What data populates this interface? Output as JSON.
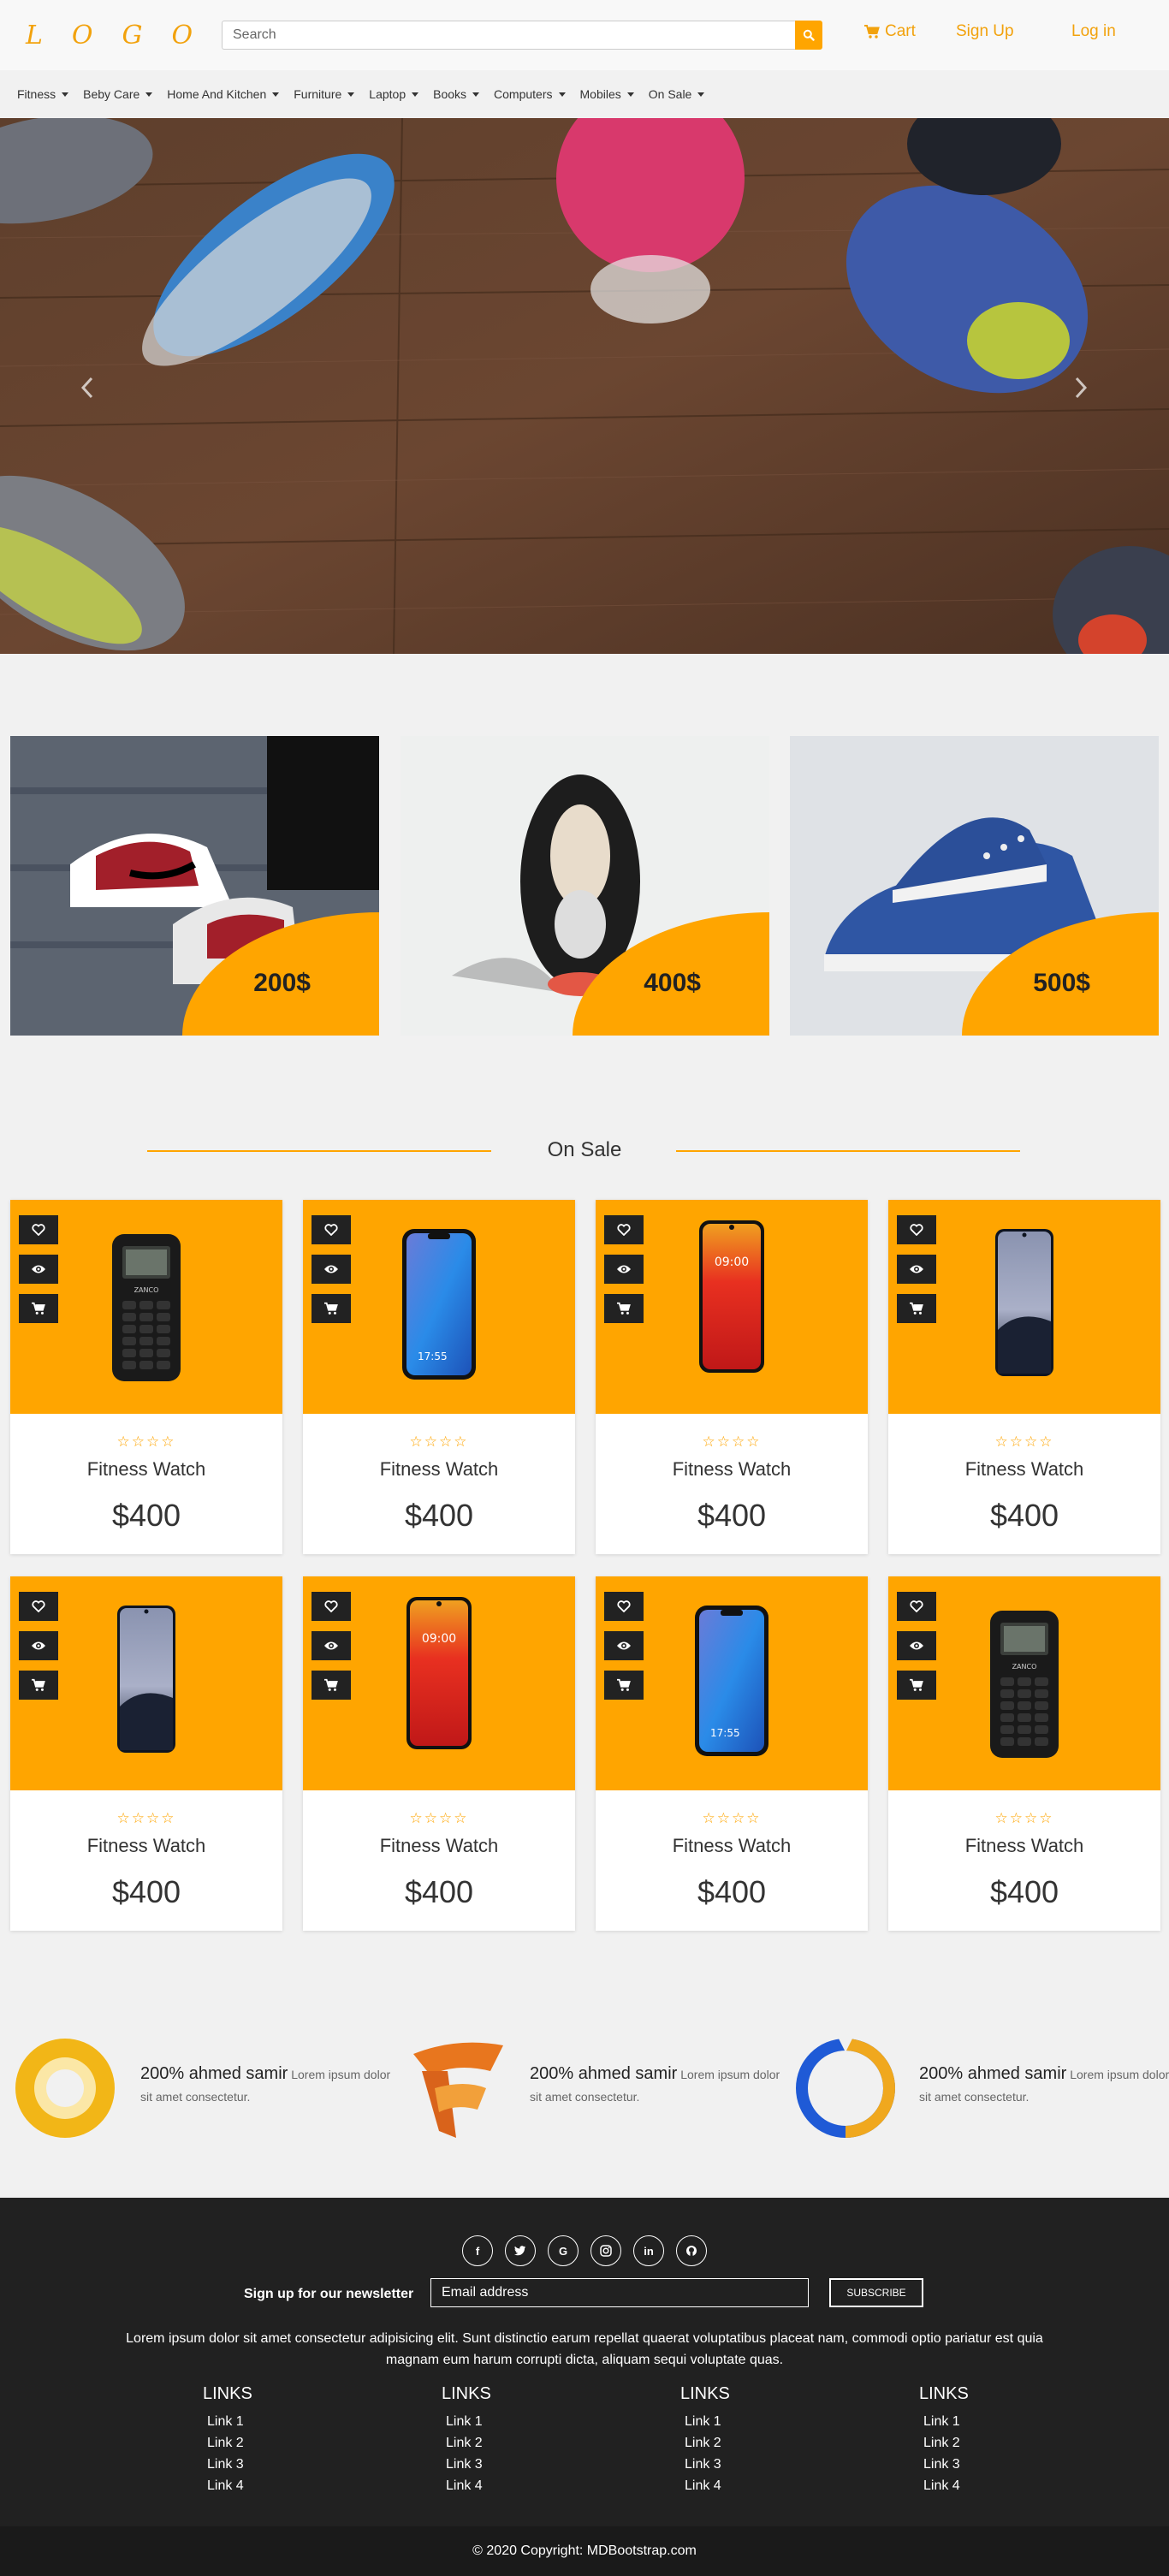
{
  "header": {
    "logo": "LOGO",
    "search_placeholder": "Search",
    "cart_label": "Cart",
    "signup_label": "Sign Up",
    "login_label": "Log in",
    "accent_color": "#ffa500"
  },
  "categories": [
    "Fitness",
    "Beby Care",
    "Home And Kitchen",
    "Furniture",
    "Laptop",
    "Books",
    "Computers",
    "Mobiles",
    "On Sale"
  ],
  "promos": [
    {
      "price": "200$"
    },
    {
      "price": "400$"
    },
    {
      "price": "500$"
    }
  ],
  "on_sale": {
    "title": "On Sale",
    "products": [
      {
        "name": "Fitness Watch",
        "price": "$400",
        "stars": "☆☆☆☆",
        "phone": "keypad"
      },
      {
        "name": "Fitness Watch",
        "price": "$400",
        "stars": "☆☆☆☆",
        "phone": "blue"
      },
      {
        "name": "Fitness Watch",
        "price": "$400",
        "stars": "☆☆☆☆",
        "phone": "red"
      },
      {
        "name": "Fitness Watch",
        "price": "$400",
        "stars": "☆☆☆☆",
        "phone": "dark"
      },
      {
        "name": "Fitness Watch",
        "price": "$400",
        "stars": "☆☆☆☆",
        "phone": "dark"
      },
      {
        "name": "Fitness Watch",
        "price": "$400",
        "stars": "☆☆☆☆",
        "phone": "red"
      },
      {
        "name": "Fitness Watch",
        "price": "$400",
        "stars": "☆☆☆☆",
        "phone": "blue"
      },
      {
        "name": "Fitness Watch",
        "price": "$400",
        "stars": "☆☆☆☆",
        "phone": "keypad"
      }
    ]
  },
  "features": [
    {
      "title": "200% ahmed samir",
      "text": "Lorem ipsum dolor sit amet consectetur."
    },
    {
      "title": "200% ahmed samir",
      "text": "Lorem ipsum dolor sit amet consectetur."
    },
    {
      "title": "200% ahmed samir",
      "text": "Lorem ipsum dolor sit amet consectetur."
    }
  ],
  "footer": {
    "socials": [
      "f",
      "t",
      "G",
      "ig",
      "in",
      "gh"
    ],
    "newsletter_label": "Sign up for our newsletter",
    "email_placeholder": "Email address",
    "subscribe_label": "Subscribe",
    "paragraph": "Lorem ipsum dolor sit amet consectetur adipisicing elit. Sunt distinctio earum repellat quaerat voluptatibus placeat nam, commodi optio pariatur est quia magnam eum harum corrupti dicta, aliquam sequi voluptate quas.",
    "link_columns": [
      {
        "heading": "LINKS",
        "links": [
          "Link 1",
          "Link 2",
          "Link 3",
          "Link 4"
        ]
      },
      {
        "heading": "LINKS",
        "links": [
          "Link 1",
          "Link 2",
          "Link 3",
          "Link 4"
        ]
      },
      {
        "heading": "LINKS",
        "links": [
          "Link 1",
          "Link 2",
          "Link 3",
          "Link 4"
        ]
      },
      {
        "heading": "LINKS",
        "links": [
          "Link 1",
          "Link 2",
          "Link 3",
          "Link 4"
        ]
      }
    ],
    "copyright": "© 2020 Copyright: MDBootstrap.com"
  }
}
